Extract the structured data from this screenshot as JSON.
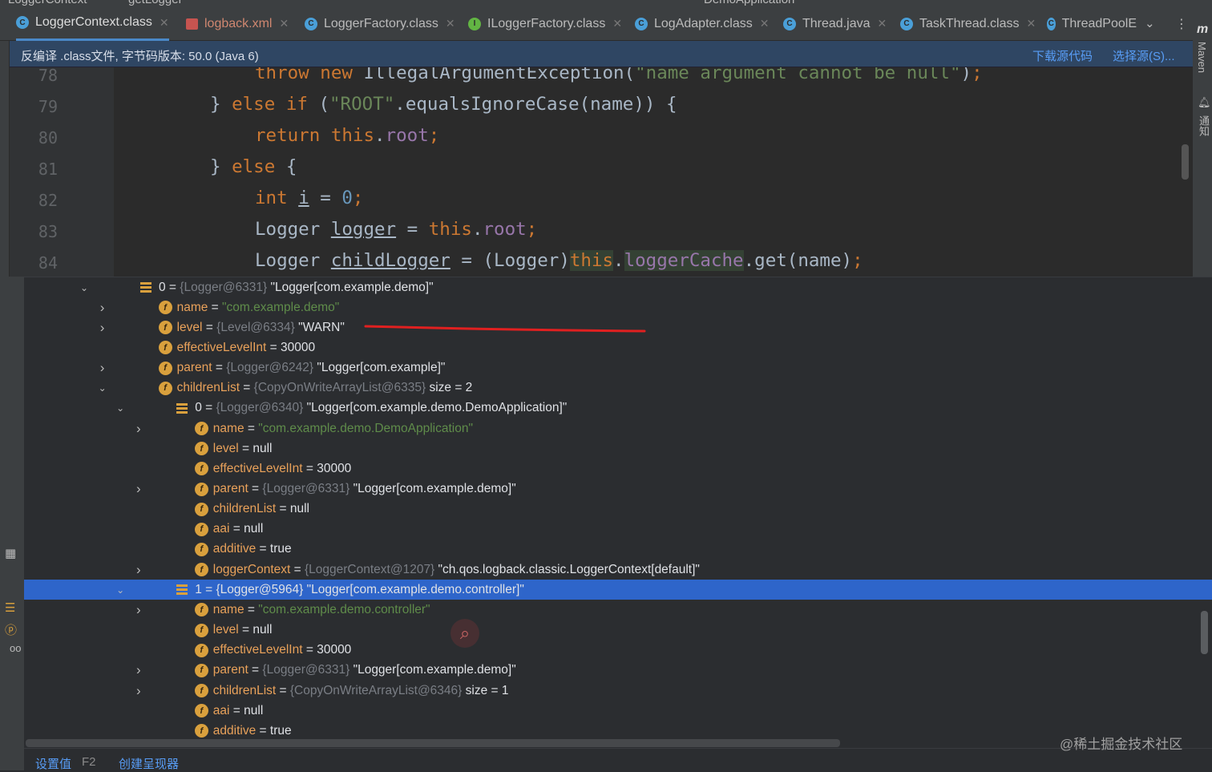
{
  "breadcrumb": [
    "LoggerContext",
    "getLogger"
  ],
  "run_config": "DemoApplication",
  "tabs": [
    {
      "label": "LoggerContext.class",
      "icon": "class-icon",
      "active": true
    },
    {
      "label": "logback.xml",
      "icon": "xml-file-icon"
    },
    {
      "label": "LoggerFactory.class",
      "icon": "class-icon"
    },
    {
      "label": "ILoggerFactory.class",
      "icon": "interface-icon"
    },
    {
      "label": "LogAdapter.class",
      "icon": "class-icon"
    },
    {
      "label": "Thread.java",
      "icon": "class-icon"
    },
    {
      "label": "TaskThread.class",
      "icon": "class-icon"
    },
    {
      "label": "ThreadPoolE",
      "icon": "class-icon"
    }
  ],
  "editor_banner": {
    "message": "反编译 .class文件, 字节码版本: 50.0 (Java 6)",
    "download_label": "下载源代码",
    "choose_label": "选择源(S)..."
  },
  "right_tools": [
    "Maven",
    "通知"
  ],
  "code": {
    "line_numbers": [
      "78",
      "79",
      "80",
      "81",
      "82",
      "83",
      "84"
    ],
    "lines": [
      "throw new IllegalArgumentException(\"name argument cannot be null\");",
      "} else if (\"ROOT\".equalsIgnoreCase(name)) {",
      "return this.root;",
      "} else {",
      "int i = 0;",
      "Logger logger = this.root;",
      "Logger childLogger = (Logger)this.loggerCache.get(name);"
    ]
  },
  "variables": {
    "rows": [
      {
        "indent": 0,
        "toggle": "expanded",
        "icon": "array",
        "name": "0",
        "sep": " = ",
        "ref": "{Logger@6331}",
        "value": " \"Logger[com.example.demo]\""
      },
      {
        "indent": 1,
        "toggle": "collapsed",
        "icon": "field",
        "name": "name",
        "sep": " = ",
        "ref": "",
        "value": "",
        "str": "\"com.example.demo\""
      },
      {
        "indent": 1,
        "toggle": "collapsed",
        "icon": "field",
        "name": "level",
        "sep": " = ",
        "ref": "{Level@6334}",
        "value": " \"WARN\""
      },
      {
        "indent": 1,
        "toggle": "none",
        "icon": "field",
        "name": "effectiveLevelInt",
        "sep": " = ",
        "ref": "",
        "value": "30000"
      },
      {
        "indent": 1,
        "toggle": "collapsed",
        "icon": "field",
        "name": "parent",
        "sep": " = ",
        "ref": "{Logger@6242}",
        "value": " \"Logger[com.example]\""
      },
      {
        "indent": 1,
        "toggle": "expanded",
        "icon": "field",
        "name": "childrenList",
        "sep": " = ",
        "ref": "{CopyOnWriteArrayList@6335}",
        "value": "  size = 2"
      },
      {
        "indent": 2,
        "toggle": "expanded",
        "icon": "array",
        "name": "0",
        "sep": " = ",
        "ref": "{Logger@6340}",
        "value": " \"Logger[com.example.demo.DemoApplication]\""
      },
      {
        "indent": 3,
        "toggle": "collapsed",
        "icon": "field",
        "name": "name",
        "sep": " = ",
        "ref": "",
        "value": "",
        "str": "\"com.example.demo.DemoApplication\""
      },
      {
        "indent": 3,
        "toggle": "none",
        "icon": "field",
        "name": "level",
        "sep": " = ",
        "ref": "",
        "value": "null"
      },
      {
        "indent": 3,
        "toggle": "none",
        "icon": "field",
        "name": "effectiveLevelInt",
        "sep": " = ",
        "ref": "",
        "value": "30000"
      },
      {
        "indent": 3,
        "toggle": "collapsed",
        "icon": "field",
        "name": "parent",
        "sep": " = ",
        "ref": "{Logger@6331}",
        "value": " \"Logger[com.example.demo]\""
      },
      {
        "indent": 3,
        "toggle": "none",
        "icon": "field",
        "name": "childrenList",
        "sep": " = ",
        "ref": "",
        "value": "null"
      },
      {
        "indent": 3,
        "toggle": "none",
        "icon": "field",
        "name": "aai",
        "sep": " = ",
        "ref": "",
        "value": "null"
      },
      {
        "indent": 3,
        "toggle": "none",
        "icon": "field",
        "name": "additive",
        "sep": " = ",
        "ref": "",
        "value": "true"
      },
      {
        "indent": 3,
        "toggle": "collapsed",
        "icon": "field",
        "name": "loggerContext",
        "sep": " = ",
        "ref": "{LoggerContext@1207}",
        "value": " \"ch.qos.logback.classic.LoggerContext[default]\""
      },
      {
        "indent": 2,
        "toggle": "expanded",
        "icon": "array",
        "name": "1",
        "sep": " = ",
        "ref": "{Logger@5964}",
        "value": " \"Logger[com.example.demo.controller]\"",
        "selected": true
      },
      {
        "indent": 3,
        "toggle": "collapsed",
        "icon": "field",
        "name": "name",
        "sep": " = ",
        "ref": "",
        "value": "",
        "str": "\"com.example.demo.controller\""
      },
      {
        "indent": 3,
        "toggle": "none",
        "icon": "field",
        "name": "level",
        "sep": " = ",
        "ref": "",
        "value": "null"
      },
      {
        "indent": 3,
        "toggle": "none",
        "icon": "field",
        "name": "effectiveLevelInt",
        "sep": " = ",
        "ref": "",
        "value": "30000"
      },
      {
        "indent": 3,
        "toggle": "collapsed",
        "icon": "field",
        "name": "parent",
        "sep": " = ",
        "ref": "{Logger@6331}",
        "value": " \"Logger[com.example.demo]\""
      },
      {
        "indent": 3,
        "toggle": "collapsed",
        "icon": "field",
        "name": "childrenList",
        "sep": " = ",
        "ref": "{CopyOnWriteArrayList@6346}",
        "value": "  size = 1"
      },
      {
        "indent": 3,
        "toggle": "none",
        "icon": "field",
        "name": "aai",
        "sep": " = ",
        "ref": "",
        "value": "null"
      },
      {
        "indent": 3,
        "toggle": "none",
        "icon": "field",
        "name": "additive",
        "sep": " = ",
        "ref": "",
        "value": "true"
      }
    ]
  },
  "bottom": {
    "set_value_label": "设置值",
    "set_value_key": "F2",
    "create_renderer_label": "创建呈现器"
  },
  "watermark": "@稀土掘金技术社区",
  "colors": {
    "accent": "#2e65ca",
    "annotation": "#e02020"
  }
}
